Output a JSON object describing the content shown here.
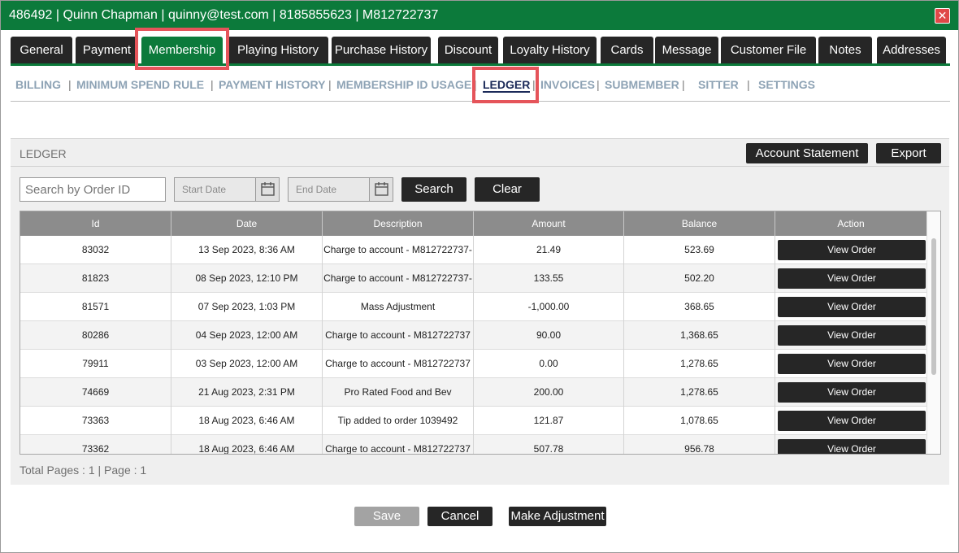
{
  "title_bar": {
    "text": "486492 | Quinn  Chapman | quinny@test.com | 8185855623 | M812722737"
  },
  "tabs": [
    {
      "label": "General",
      "active": false
    },
    {
      "label": "Payment",
      "active": false
    },
    {
      "label": "Membership",
      "active": true
    },
    {
      "label": "Playing History",
      "active": false
    },
    {
      "label": "Purchase History",
      "active": false
    },
    {
      "label": "Discount",
      "active": false
    },
    {
      "label": "Loyalty History",
      "active": false
    },
    {
      "label": "Cards",
      "active": false
    },
    {
      "label": "Message",
      "active": false
    },
    {
      "label": "Customer File",
      "active": false
    },
    {
      "label": "Notes",
      "active": false
    },
    {
      "label": "Addresses",
      "active": false
    }
  ],
  "subnav": [
    {
      "label": "BILLING"
    },
    {
      "label": "MINIMUM SPEND RULE"
    },
    {
      "label": "PAYMENT HISTORY"
    },
    {
      "label": "MEMBERSHIP ID USAGE"
    },
    {
      "label": "LEDGER",
      "active": true
    },
    {
      "label": "INVOICES"
    },
    {
      "label": "SUBMEMBER"
    },
    {
      "label": "SITTER"
    },
    {
      "label": "SETTINGS"
    }
  ],
  "panel": {
    "title": "LEDGER",
    "account_statement_label": "Account Statement",
    "export_label": "Export",
    "search_placeholder": "Search by Order ID",
    "start_date_placeholder": "Start Date",
    "end_date_placeholder": "End Date",
    "search_label": "Search",
    "clear_label": "Clear",
    "pagination": "Total Pages : 1 | Page : 1"
  },
  "table": {
    "headers": [
      "Id",
      "Date",
      "Description",
      "Amount",
      "Balance",
      "Action"
    ],
    "action_label": "View Order",
    "rows": [
      {
        "id": "83032",
        "date": "13 Sep 2023, 8:36 AM",
        "description": "Charge to account - M812722737-",
        "amount": "21.49",
        "balance": "523.69"
      },
      {
        "id": "81823",
        "date": "08 Sep 2023, 12:10 PM",
        "description": "Charge to account - M812722737-",
        "amount": "133.55",
        "balance": "502.20"
      },
      {
        "id": "81571",
        "date": "07 Sep 2023, 1:03 PM",
        "description": "Mass Adjustment",
        "amount": "-1,000.00",
        "balance": "368.65"
      },
      {
        "id": "80286",
        "date": "04 Sep 2023, 12:00 AM",
        "description": "Charge to account - M812722737",
        "amount": "90.00",
        "balance": "1,368.65"
      },
      {
        "id": "79911",
        "date": "03 Sep 2023, 12:00 AM",
        "description": "Charge to account - M812722737",
        "amount": "0.00",
        "balance": "1,278.65"
      },
      {
        "id": "74669",
        "date": "21 Aug 2023, 2:31 PM",
        "description": "Pro Rated Food and Bev",
        "amount": "200.00",
        "balance": "1,278.65"
      },
      {
        "id": "73363",
        "date": "18 Aug 2023, 6:46 AM",
        "description": "Tip added to order 1039492",
        "amount": "121.87",
        "balance": "1,078.65"
      },
      {
        "id": "73362",
        "date": "18 Aug 2023, 6:46 AM",
        "description": "Charge to account - M812722737",
        "amount": "507.78",
        "balance": "956.78"
      }
    ]
  },
  "footer": {
    "save_label": "Save",
    "cancel_label": "Cancel",
    "make_adjustment_label": "Make Adjustment"
  },
  "colors": {
    "brand_green": "#0c7a3b",
    "dark_button": "#262626",
    "highlight_red": "#e5545a",
    "subnav_inactive": "#8ea3b5",
    "subnav_active": "#1b2a59"
  }
}
